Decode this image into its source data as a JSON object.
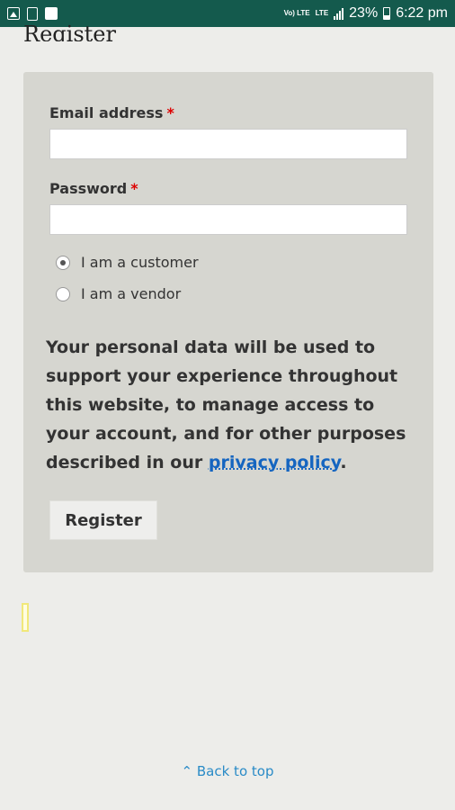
{
  "status_bar": {
    "network_label": "Vo) LTE",
    "lte_label": "LTE",
    "battery": "23%",
    "time": "6:22 pm"
  },
  "page": {
    "title": "Register"
  },
  "form": {
    "email_label": "Email address",
    "password_label": "Password",
    "required_mark": "*",
    "email_value": "",
    "password_value": "",
    "roles": [
      {
        "label": "I am a customer",
        "checked": true
      },
      {
        "label": "I am a vendor",
        "checked": false
      }
    ],
    "privacy_text": "Your personal data will be used to support your experience throughout this website, to manage access to your account, and for other purposes described in our",
    "privacy_link": "privacy policy",
    "privacy_end": ".",
    "register_label": "Register"
  },
  "footer": {
    "back_to_top": "Back to top"
  },
  "colors": {
    "status_bar": "#145a4d",
    "card": "#d6d6d0",
    "link": "#1565c0",
    "required": "#dd0000"
  }
}
